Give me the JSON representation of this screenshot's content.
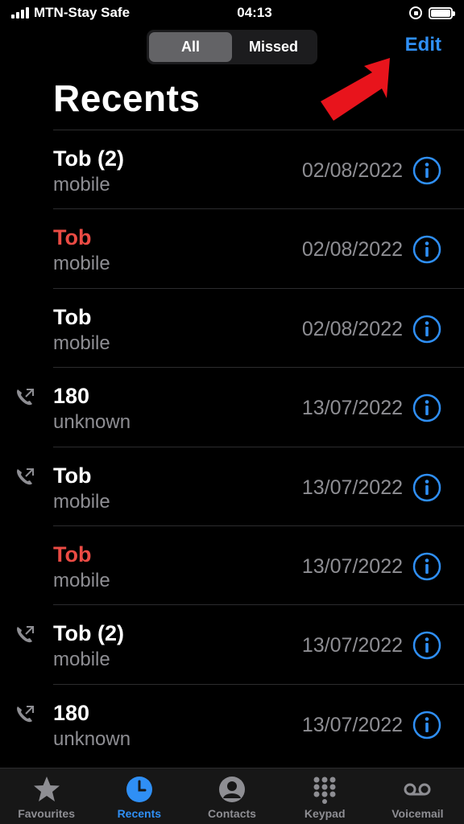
{
  "status_bar": {
    "carrier": "MTN-Stay Safe",
    "time": "04:13",
    "battery_level": 1.0
  },
  "segmented": {
    "options": [
      "All",
      "Missed"
    ],
    "selected": "All"
  },
  "header": {
    "edit_label": "Edit",
    "title": "Recents"
  },
  "calls": [
    {
      "name": "Tob (2)",
      "type": "mobile",
      "date": "02/08/2022",
      "missed": false,
      "outgoing": false
    },
    {
      "name": "Tob",
      "type": "mobile",
      "date": "02/08/2022",
      "missed": true,
      "outgoing": false
    },
    {
      "name": "Tob",
      "type": "mobile",
      "date": "02/08/2022",
      "missed": false,
      "outgoing": false
    },
    {
      "name": "180",
      "type": "unknown",
      "date": "13/07/2022",
      "missed": false,
      "outgoing": true
    },
    {
      "name": "Tob",
      "type": "mobile",
      "date": "13/07/2022",
      "missed": false,
      "outgoing": true
    },
    {
      "name": "Tob",
      "type": "mobile",
      "date": "13/07/2022",
      "missed": true,
      "outgoing": false
    },
    {
      "name": "Tob (2)",
      "type": "mobile",
      "date": "13/07/2022",
      "missed": false,
      "outgoing": true
    },
    {
      "name": "180",
      "type": "unknown",
      "date": "13/07/2022",
      "missed": false,
      "outgoing": true
    }
  ],
  "tabs": [
    {
      "label": "Favourites",
      "icon": "star-icon",
      "active": false
    },
    {
      "label": "Recents",
      "icon": "clock-icon",
      "active": true
    },
    {
      "label": "Contacts",
      "icon": "person-icon",
      "active": false
    },
    {
      "label": "Keypad",
      "icon": "keypad-icon",
      "active": false
    },
    {
      "label": "Voicemail",
      "icon": "voicemail-icon",
      "active": false
    }
  ],
  "colors": {
    "accent": "#2f8ff5",
    "missed": "#eb4b44",
    "secondary_text": "#8e8e93",
    "annotation_arrow": "#e8141c"
  }
}
